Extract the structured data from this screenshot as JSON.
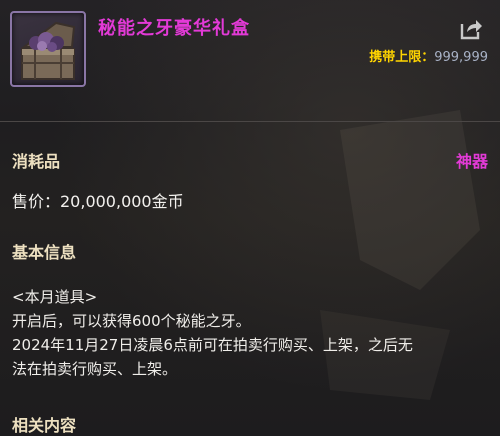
{
  "item": {
    "name": "秘能之牙豪华礼盒",
    "carry_limit_label": "携带上限：",
    "carry_limit_value": "999,999",
    "category": "消耗品",
    "grade": "神器",
    "price": "售价：20,000,000金币"
  },
  "sections": {
    "basic_info_title": "基本信息",
    "related_title": "相关内容"
  },
  "description": [
    "<本月道具>",
    "开启后，可以获得600个秘能之牙。",
    "2024年11月27日凌晨6点前可在拍卖行购买、上架，之后无",
    "法在拍卖行购买、上架。"
  ],
  "colors": {
    "title": "#e33ad7",
    "grade": "#e33ad7",
    "carry_label": "#ffd400",
    "section": "#ede0c0"
  }
}
